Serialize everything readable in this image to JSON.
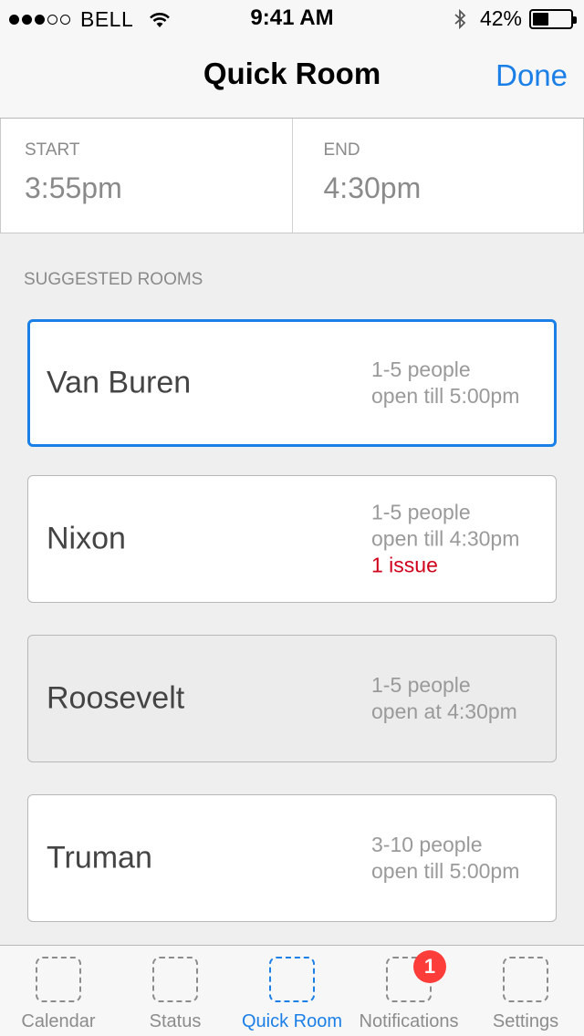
{
  "status_bar": {
    "carrier": "BELL",
    "signal_filled": 3,
    "signal_total": 5,
    "time": "9:41 AM",
    "battery_percent": "42%",
    "battery_level": 0.42
  },
  "nav": {
    "title": "Quick Room",
    "done_label": "Done"
  },
  "times": {
    "start_label": "START",
    "start_value": "3:55pm",
    "end_label": "END",
    "end_value": "4:30pm"
  },
  "section_label": "SUGGESTED ROOMS",
  "rooms": [
    {
      "name": "Van Buren",
      "capacity": "1-5 people",
      "availability": "open till 5:00pm",
      "issue": "",
      "state": "selected"
    },
    {
      "name": "Nixon",
      "capacity": "1-5 people",
      "availability": "open till 4:30pm",
      "issue": "1 issue",
      "state": "normal"
    },
    {
      "name": "Roosevelt",
      "capacity": "1-5 people",
      "availability": "open at 4:30pm",
      "issue": "",
      "state": "unavailable"
    },
    {
      "name": "Truman",
      "capacity": "3-10 people",
      "availability": "open till 5:00pm",
      "issue": "",
      "state": "normal"
    }
  ],
  "tabs": [
    {
      "label": "Calendar",
      "active": false,
      "badge": ""
    },
    {
      "label": "Status",
      "active": false,
      "badge": ""
    },
    {
      "label": "Quick Room",
      "active": true,
      "badge": ""
    },
    {
      "label": "Notifications",
      "active": false,
      "badge": "1"
    },
    {
      "label": "Settings",
      "active": false,
      "badge": ""
    }
  ],
  "colors": {
    "accent": "#1a7fe6",
    "issue": "#d0021b",
    "badge": "#fc3d39"
  }
}
